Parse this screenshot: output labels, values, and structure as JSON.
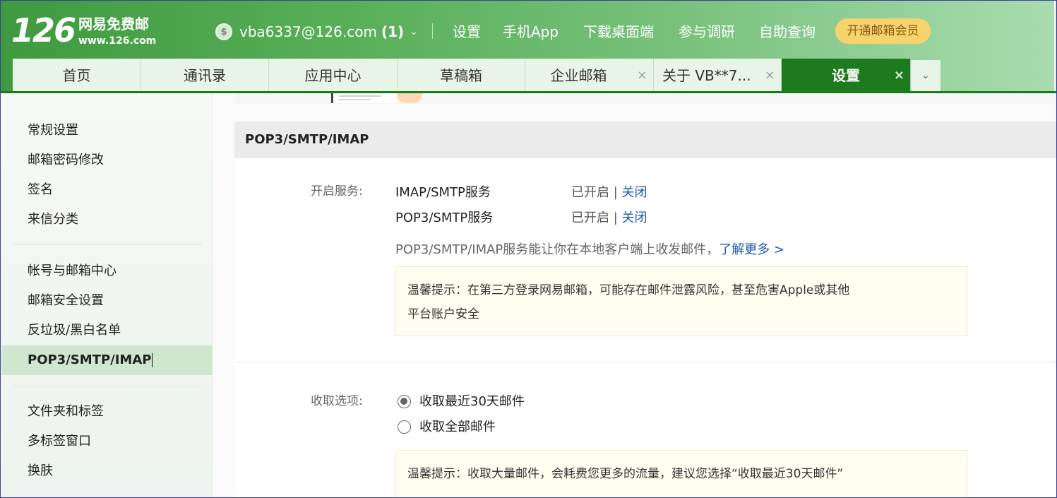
{
  "header": {
    "logo_number": "126",
    "logo_title": "网易免费邮",
    "logo_url": "www.126.com",
    "account_email": "vba6337@126.com",
    "account_unread": "(1)",
    "nav": [
      "设置",
      "手机App",
      "下载桌面端",
      "参与调研",
      "自助查询"
    ],
    "vip_label": "开通邮箱会员"
  },
  "tabs": [
    {
      "label": "首页",
      "closable": false,
      "active": false
    },
    {
      "label": "通讯录",
      "closable": false,
      "active": false
    },
    {
      "label": "应用中心",
      "closable": false,
      "active": false
    },
    {
      "label": "草稿箱",
      "closable": false,
      "active": false
    },
    {
      "label": "企业邮箱",
      "closable": true,
      "active": false
    },
    {
      "label": "关于 VB**7...",
      "closable": true,
      "active": false
    },
    {
      "label": "设置",
      "closable": true,
      "active": true
    }
  ],
  "tab_close_glyph": "×",
  "tab_more_glyph": "⌄",
  "sidebar": {
    "group1": [
      "常规设置",
      "邮箱密码修改",
      "签名",
      "来信分类"
    ],
    "group2": [
      "帐号与邮箱中心",
      "邮箱安全设置",
      "反垃圾/黑白名单",
      "POP3/SMTP/IMAP"
    ],
    "group3": [
      "文件夹和标签",
      "多标签窗口",
      "换肤"
    ],
    "active_item": "POP3/SMTP/IMAP"
  },
  "main": {
    "section_title": "POP3/SMTP/IMAP",
    "services_label": "开启服务:",
    "services": [
      {
        "name": "IMAP/SMTP服务",
        "status": "已开启",
        "sep": "|",
        "action": "关闭"
      },
      {
        "name": "POP3/SMTP服务",
        "status": "已开启",
        "sep": "|",
        "action": "关闭"
      }
    ],
    "description": "POP3/SMTP/IMAP服务能让你在本地客户端上收发邮件，",
    "learn_more": "了解更多 >",
    "tip1_line1": "温馨提示：在第三方登录网易邮箱，可能存在邮件泄露风险，甚至危害Apple或其他",
    "tip1_line2": "平台账户安全",
    "receive_label": "收取选项:",
    "receive_options": [
      {
        "label": "收取最近30天邮件",
        "checked": true
      },
      {
        "label": "收取全部邮件",
        "checked": false
      }
    ],
    "tip2": "温馨提示：收取大量邮件，会耗费您更多的流量，建议您选择“收取最近30天邮件”"
  },
  "colors": {
    "header_green": "#3f9a3f",
    "active_tab": "#1e7a1e",
    "sidebar_active": "#cfe6cf",
    "vip_bg": "#f6d36b",
    "link": "#1a5aa8",
    "tip_bg": "#fffef0"
  }
}
